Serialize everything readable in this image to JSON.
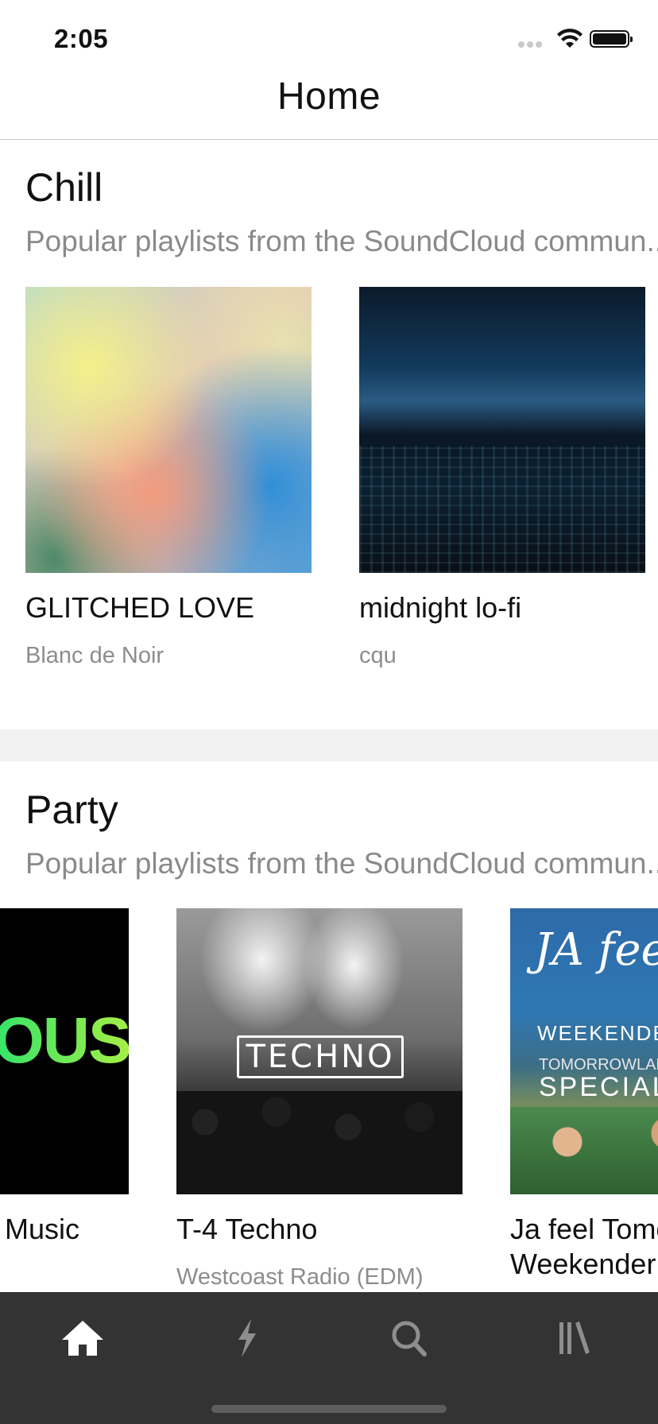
{
  "status_bar": {
    "time": "2:05",
    "icons": [
      "signal-icon",
      "wifi-icon",
      "battery-icon"
    ]
  },
  "header": {
    "title": "Home"
  },
  "sections": [
    {
      "title": "Chill",
      "subtitle": "Popular playlists from the SoundCloud commun...",
      "items": [
        {
          "title": "GLITCHED LOVE",
          "subtitle": "Blanc de Noir"
        },
        {
          "title": "midnight lo-fi",
          "subtitle": "cqu"
        }
      ]
    },
    {
      "title": "Party",
      "subtitle": "Popular playlists from the SoundCloud commun...",
      "items": [
        {
          "title": "Music",
          "subtitle": "",
          "art_text": "OUSE"
        },
        {
          "title": "T-4 Techno",
          "subtitle": "Westcoast Radio (EDM)",
          "art_text": "TECHNO"
        },
        {
          "title": "Ja feel Tomor\nWeekender",
          "subtitle": "",
          "art_logo": "JA feel",
          "art_line1": "WEEKENDER",
          "art_line2": "TOMORROWLAND",
          "art_line3": "SPECIAL"
        }
      ]
    }
  ],
  "tab_bar": {
    "tabs": [
      {
        "icon": "home-icon",
        "active": true
      },
      {
        "icon": "stream-icon",
        "active": false
      },
      {
        "icon": "search-icon",
        "active": false
      },
      {
        "icon": "library-icon",
        "active": false
      }
    ],
    "active_color": "#ffffff",
    "inactive_color": "#8e8e8e"
  },
  "colors": {
    "background": "#ffffff",
    "tab_bar": "#333333",
    "divider": "#f2f2f2",
    "subtitle": "#8a8a8a"
  }
}
